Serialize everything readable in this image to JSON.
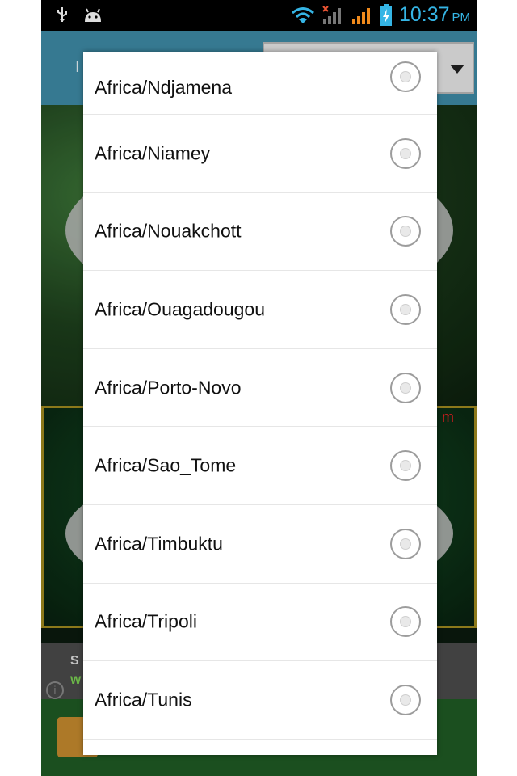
{
  "status_bar": {
    "time": "10:37",
    "ampm": "PM",
    "icons": [
      "usb-icon",
      "android-icon",
      "wifi-icon",
      "signal-off-icon",
      "signal-icon",
      "battery-charging-icon"
    ]
  },
  "background": {
    "header_text": "I",
    "alarm_text": "m",
    "ad_title": "S",
    "ad_sub": "W",
    "info_icon": "i"
  },
  "dialog": {
    "items": [
      {
        "label": "Africa/Ndjamena",
        "selected": false
      },
      {
        "label": "Africa/Niamey",
        "selected": false
      },
      {
        "label": "Africa/Nouakchott",
        "selected": false
      },
      {
        "label": "Africa/Ouagadougou",
        "selected": false
      },
      {
        "label": "Africa/Porto-Novo",
        "selected": false
      },
      {
        "label": "Africa/Sao_Tome",
        "selected": false
      },
      {
        "label": "Africa/Timbuktu",
        "selected": false
      },
      {
        "label": "Africa/Tripoli",
        "selected": false
      },
      {
        "label": "Africa/Tunis",
        "selected": false
      }
    ]
  },
  "colors": {
    "clock": "#35b5e5",
    "header": "#3e8aa6",
    "dialog_bg": "#ffffff"
  }
}
